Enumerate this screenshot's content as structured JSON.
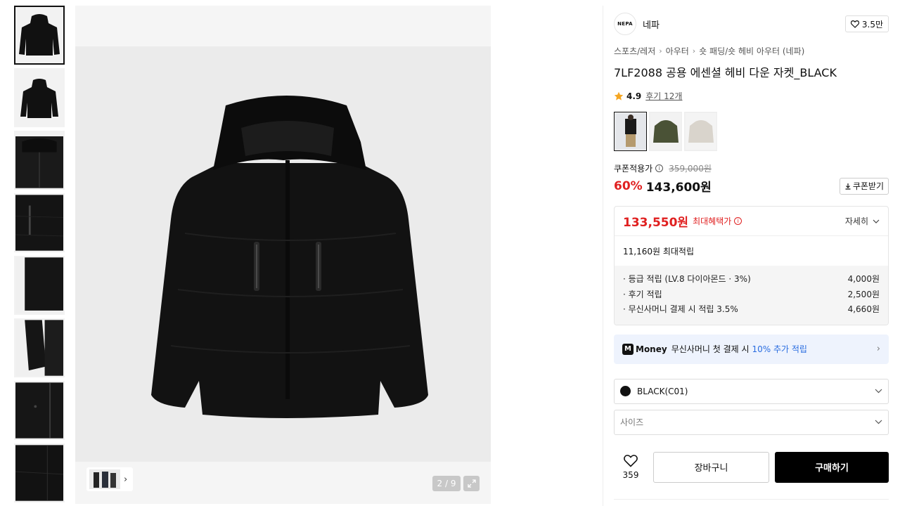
{
  "gallery": {
    "thumbnails": [
      {
        "name": "front"
      },
      {
        "name": "back"
      },
      {
        "name": "collar-detail"
      },
      {
        "name": "zipper-detail"
      },
      {
        "name": "side-detail"
      },
      {
        "name": "cuff-detail"
      },
      {
        "name": "pocket-detail"
      },
      {
        "name": "hem-detail"
      }
    ],
    "pager": "2 / 9",
    "active_thumbnail": 0
  },
  "brand": {
    "logo_text": "NEPA",
    "name": "네파",
    "likes": "3.5만"
  },
  "breadcrumb": [
    "스포츠/레저",
    "아우터",
    "숏 패딩/숏 헤비 아우터 (네파)"
  ],
  "product": {
    "title": "7LF2088 공용 에센셜 헤비 다운 자켓_BLACK",
    "rating": "4.9",
    "reviews": "후기 12개"
  },
  "colors": {
    "swatches": [
      "#1a1a1a",
      "#4a5236",
      "#d9d4cc"
    ],
    "active": 0
  },
  "pricing": {
    "coupon_label": "쿠폰적용가",
    "original_price": "359,000원",
    "discount": "60%",
    "price": "143,600원",
    "coupon_button": "쿠폰받기",
    "max_benefit_price": "133,550원",
    "max_benefit_label": "최대혜택가",
    "detail_label": "자세히",
    "max_points": "11,160원 최대적립",
    "point_items": [
      {
        "label": "· 등급 적립 (LV.8 다이아몬드 · 3%)",
        "value": "4,000원"
      },
      {
        "label": "· 후기 적립",
        "value": "2,500원"
      },
      {
        "label": "· 무신사머니 결제 시 적립 3.5%",
        "value": "4,660원"
      }
    ]
  },
  "money_banner": {
    "logo": "M",
    "brand": "Money",
    "text": "무신사머니 첫 결제 시",
    "highlight": "10% 추가 적립"
  },
  "options": {
    "color_value": "BLACK(C01)",
    "size_placeholder": "사이즈"
  },
  "actions": {
    "wish_count": "359",
    "cart_label": "장바구니",
    "buy_label": "구매하기"
  },
  "theme": {
    "accent_red": "#e02020",
    "link_blue": "#2a6de0",
    "star": "#f5a623"
  }
}
